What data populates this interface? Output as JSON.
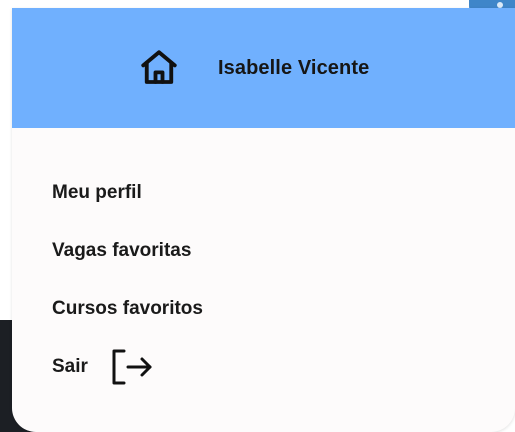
{
  "header": {
    "user_name": "Isabelle Vicente",
    "home_icon": "home-icon",
    "background_color": "#70b0fe"
  },
  "menu": {
    "items": [
      {
        "label": "Meu perfil"
      },
      {
        "label": "Vagas favoritas"
      },
      {
        "label": "Cursos favoritos"
      },
      {
        "label": "Sair",
        "icon": "logout-icon"
      }
    ]
  }
}
